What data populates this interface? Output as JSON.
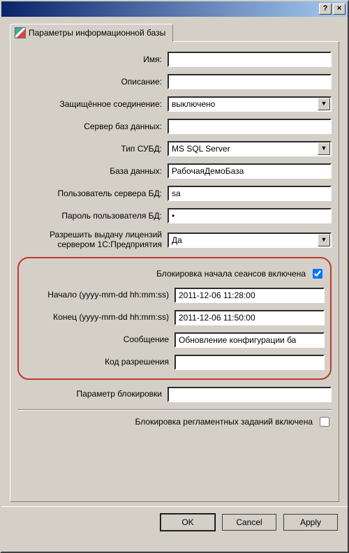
{
  "titlebar": {
    "help_btn": "?",
    "close_btn": "×"
  },
  "tab": "Параметры информационной базы",
  "fields": {
    "name_label": "Имя:",
    "name_value": "",
    "desc_label": "Описание:",
    "desc_value": "",
    "secure_label": "Защищённое соединение:",
    "secure_value": "выключено",
    "dbserver_label": "Сервер баз данных:",
    "dbserver_value": "",
    "dbms_label": "Тип СУБД:",
    "dbms_value": "MS SQL Server",
    "dbname_label": "База данных:",
    "dbname_value": "РабочаяДемоБаза",
    "dbuser_label": "Пользователь сервера БД:",
    "dbuser_value": "sa",
    "dbpass_label": "Пароль пользователя БД:",
    "dbpass_value": "•",
    "license_label": "Разрешить выдачу лицензий сервером 1С:Предприятия",
    "license_value": "Да"
  },
  "lock": {
    "enabled_label": "Блокировка начала сеансов включена",
    "enabled_checked": true,
    "start_label": "Начало (yyyy-mm-dd hh:mm:ss)",
    "start_value": "2011-12-06 11:28:00",
    "end_label": "Конец (yyyy-mm-dd hh:mm:ss)",
    "end_value": "2011-12-06 11:50:00",
    "message_label": "Сообщение",
    "message_value": "Обновление конфигурации ба",
    "code_label": "Код разрешения",
    "code_value": ""
  },
  "lockparam": {
    "label": "Параметр блокировки",
    "value": ""
  },
  "regjobs": {
    "label": "Блокировка регламентных заданий включена",
    "checked": false
  },
  "buttons": {
    "ok": "OK",
    "cancel": "Cancel",
    "apply": "Apply"
  }
}
